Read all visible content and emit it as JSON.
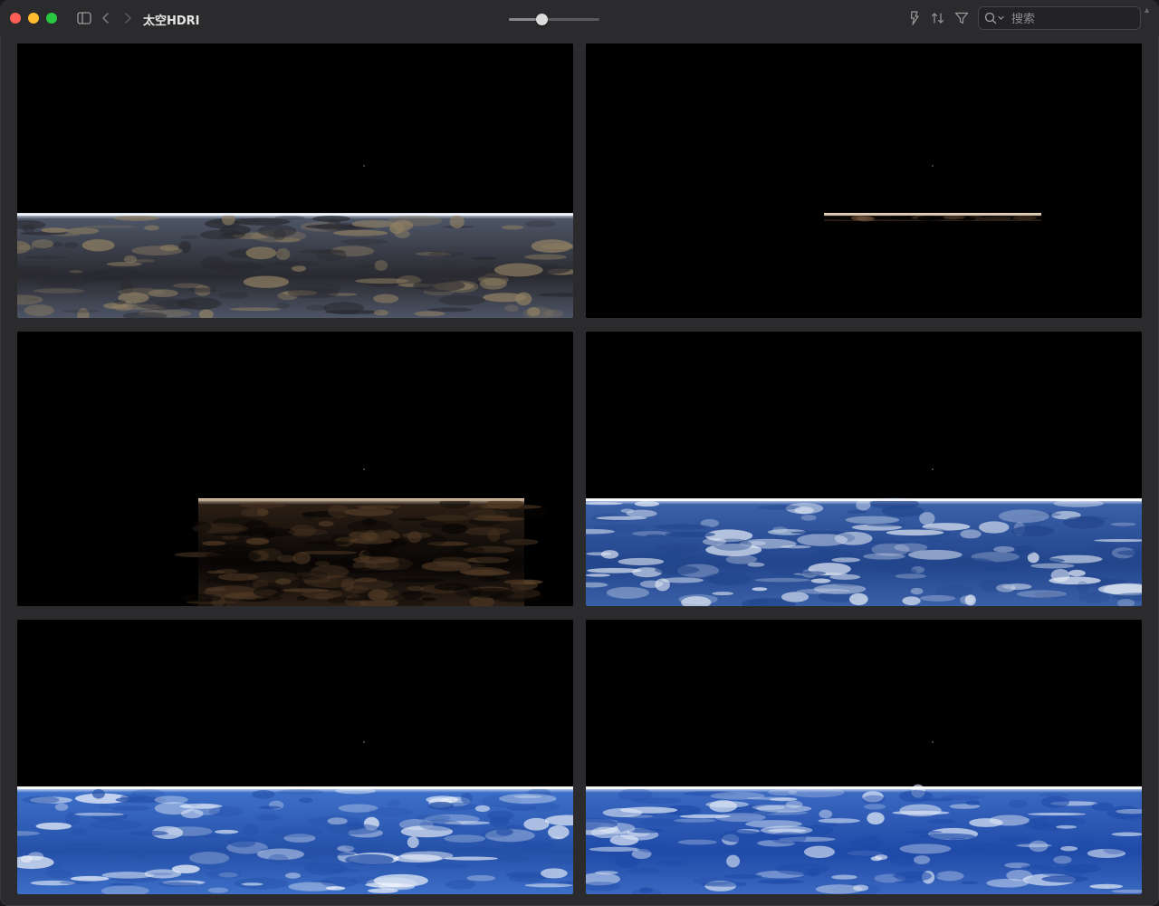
{
  "window": {
    "title": "太空HDRI"
  },
  "toolbar": {
    "sidebar_toggle_icon": "sidebar-icon",
    "back_icon": "chevron-left-icon",
    "forward_icon": "chevron-right-icon",
    "size_slider_value": 0.36,
    "actions": [
      {
        "name": "quick-actions",
        "icon": "lightning-icon"
      },
      {
        "name": "sort",
        "icon": "sort-arrows-icon"
      },
      {
        "name": "filter",
        "icon": "funnel-icon"
      }
    ],
    "search": {
      "placeholder": "搜索",
      "value": "",
      "icon": "magnifier-icon"
    }
  },
  "gallery": {
    "tiles": [
      {
        "kind": "rocky",
        "horizon": 0.62,
        "spread": "full"
      },
      {
        "kind": "thin-glow",
        "horizon": 0.62,
        "spread": "narrow"
      },
      {
        "kind": "dusk",
        "horizon": 0.61,
        "spread": "partial"
      },
      {
        "kind": "clouds",
        "horizon": 0.61,
        "spread": "full"
      },
      {
        "kind": "clouds-bright",
        "horizon": 0.61,
        "spread": "full"
      },
      {
        "kind": "clouds-deep",
        "horizon": 0.61,
        "spread": "full"
      }
    ]
  },
  "colors": {
    "window_bg": "#2b2b2d",
    "tile_bg": "#000000",
    "close": "#ff5f57",
    "minimize": "#febc2e",
    "zoom": "#28c840"
  }
}
